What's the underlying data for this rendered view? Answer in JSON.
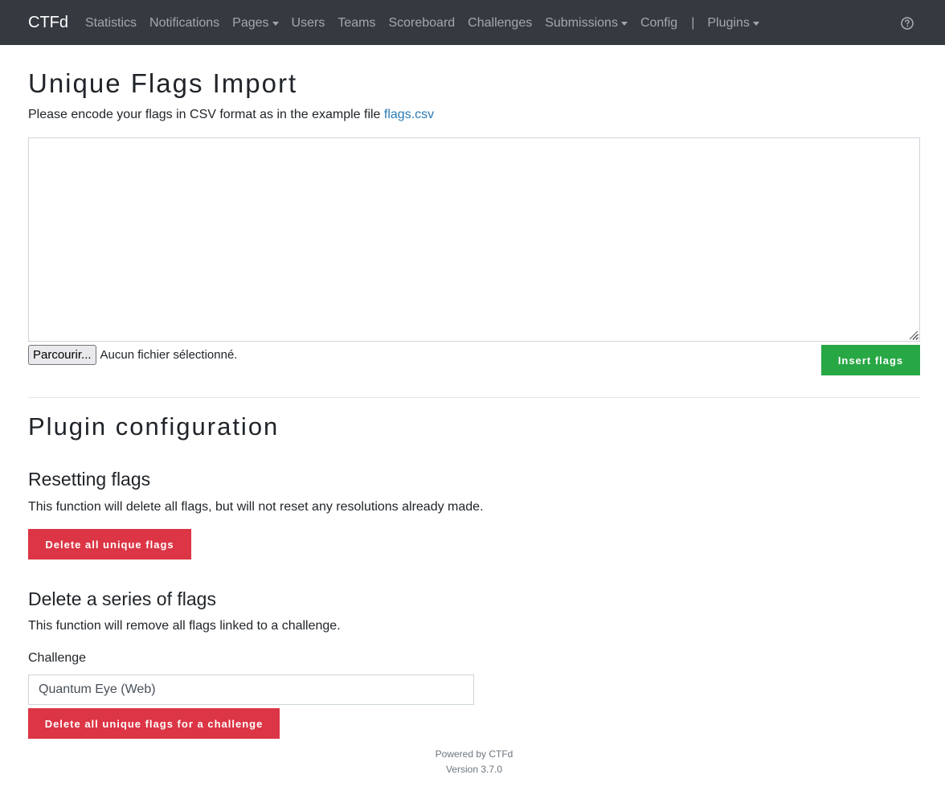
{
  "navbar": {
    "brand": "CTFd",
    "items": [
      {
        "label": "Statistics",
        "dropdown": false
      },
      {
        "label": "Notifications",
        "dropdown": false
      },
      {
        "label": "Pages",
        "dropdown": true
      },
      {
        "label": "Users",
        "dropdown": false
      },
      {
        "label": "Teams",
        "dropdown": false
      },
      {
        "label": "Scoreboard",
        "dropdown": false
      },
      {
        "label": "Challenges",
        "dropdown": false
      },
      {
        "label": "Submissions",
        "dropdown": true
      },
      {
        "label": "Config",
        "dropdown": false
      }
    ],
    "separator": "|",
    "plugins_label": "Plugins",
    "help_icon": "question-circle-icon"
  },
  "import": {
    "title": "Unique Flags Import",
    "description": "Please encode your flags in CSV format as in the example file ",
    "example_link": "flags.csv",
    "textarea_value": "",
    "file_button": "Parcourir...",
    "file_status": "Aucun fichier sélectionné.",
    "insert_button": "Insert flags"
  },
  "config": {
    "title": "Plugin configuration",
    "reset": {
      "heading": "Resetting flags",
      "text": "This function will delete all flags, but will not reset any resolutions already made.",
      "button": "Delete all unique flags"
    },
    "series": {
      "heading": "Delete a series of flags",
      "text": "This function will remove all flags linked to a challenge.",
      "label": "Challenge",
      "selected": "Quantum Eye (Web)",
      "button": "Delete all unique flags for a challenge"
    }
  },
  "footer": {
    "powered": "Powered by CTFd",
    "version": "Version 3.7.0"
  },
  "colors": {
    "navbar": "#343a40",
    "success": "#28a745",
    "danger": "#dc3545",
    "link": "#2a7ab5"
  }
}
